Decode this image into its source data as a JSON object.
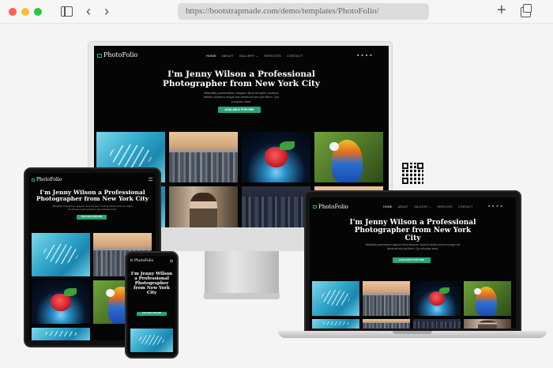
{
  "browser": {
    "url": "https://bootstrapmade.com/demo/templates/PhotoFolio/",
    "traffic_colors": [
      "#ff5f57",
      "#febc2e",
      "#28c840"
    ]
  },
  "site": {
    "logo": "PhotoFolio",
    "nav": [
      "HOME",
      "ABOUT",
      "GALLERY ⌄",
      "SERVICES",
      "CONTACT"
    ],
    "hero_prefix": "I'm",
    "hero_name": "Jenny Wilson",
    "hero_suffix": "a Professional",
    "hero_line2": "Photographer from New York City",
    "hero_sub": "Blanditiis praesentium aliquam illum tempore incidunt debitis dolorem magni est deserunt sed qui libero. Qui voluptas amet.",
    "cta": "AVAILABLE FOR HIRE",
    "accent": "#27a776"
  }
}
